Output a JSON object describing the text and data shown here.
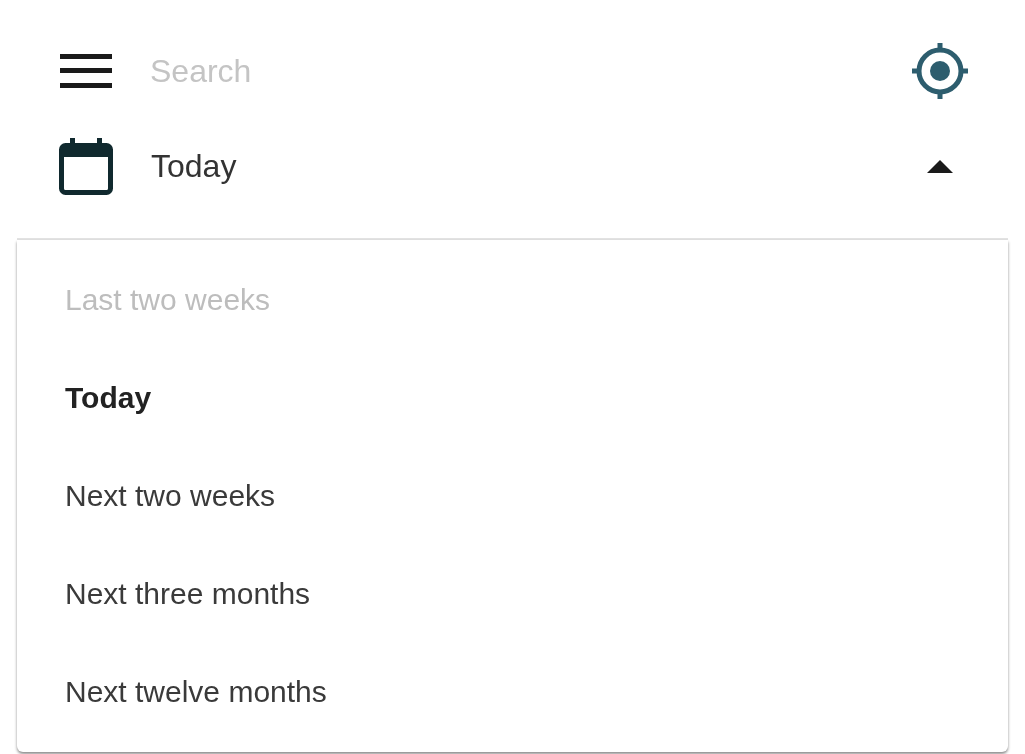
{
  "search": {
    "placeholder": "Search"
  },
  "date_filter": {
    "value": "Today",
    "expanded": true
  },
  "menu": [
    {
      "label": "Last two weeks",
      "selected": false,
      "disabled": true
    },
    {
      "label": "Today",
      "selected": true,
      "disabled": false
    },
    {
      "label": "Next two weeks",
      "selected": false,
      "disabled": false
    },
    {
      "label": "Next three months",
      "selected": false,
      "disabled": false
    },
    {
      "label": "Next twelve months",
      "selected": false,
      "disabled": false
    }
  ]
}
